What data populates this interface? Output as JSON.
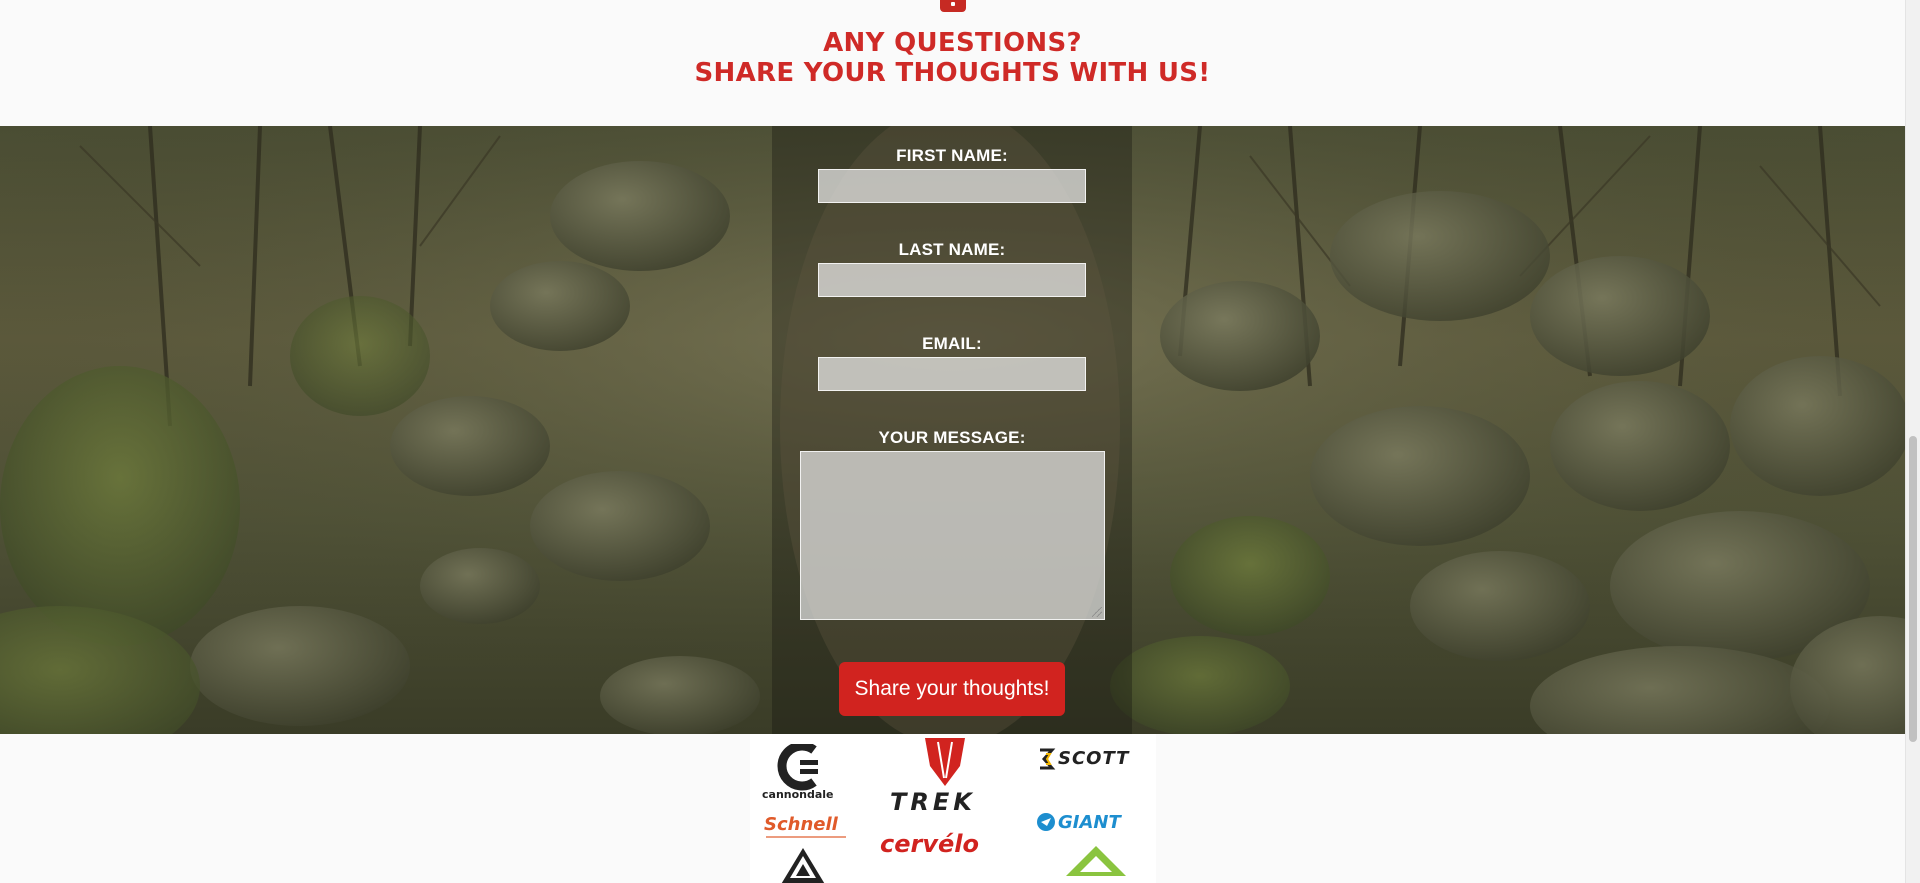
{
  "header": {
    "icon": "lock-icon",
    "headline_line1": "ANY QUESTIONS?",
    "headline_line2": "SHARE YOUR THOUGHTS WITH US!",
    "accent_color": "#cf2a27"
  },
  "form": {
    "first_name_label": "FIRST NAME:",
    "first_name_value": "",
    "last_name_label": "LAST NAME:",
    "last_name_value": "",
    "email_label": "EMAIL:",
    "email_value": "",
    "message_label": "YOUR MESSAGE:",
    "message_value": "",
    "submit_label": "Share your thoughts!",
    "submit_color": "#d1231f"
  },
  "logos": {
    "items": [
      {
        "name": "cannondale",
        "icon": "cannondale-logo-icon"
      },
      {
        "name": "TREK",
        "icon": "trek-logo-icon"
      },
      {
        "name": "SCOTT",
        "icon": "scott-logo-icon"
      },
      {
        "name": "Schnell",
        "icon": "schnell-logo-icon"
      },
      {
        "name": "cervélo",
        "icon": "cervelo-logo-icon"
      },
      {
        "name": "GIANT",
        "icon": "giant-logo-icon"
      }
    ]
  }
}
